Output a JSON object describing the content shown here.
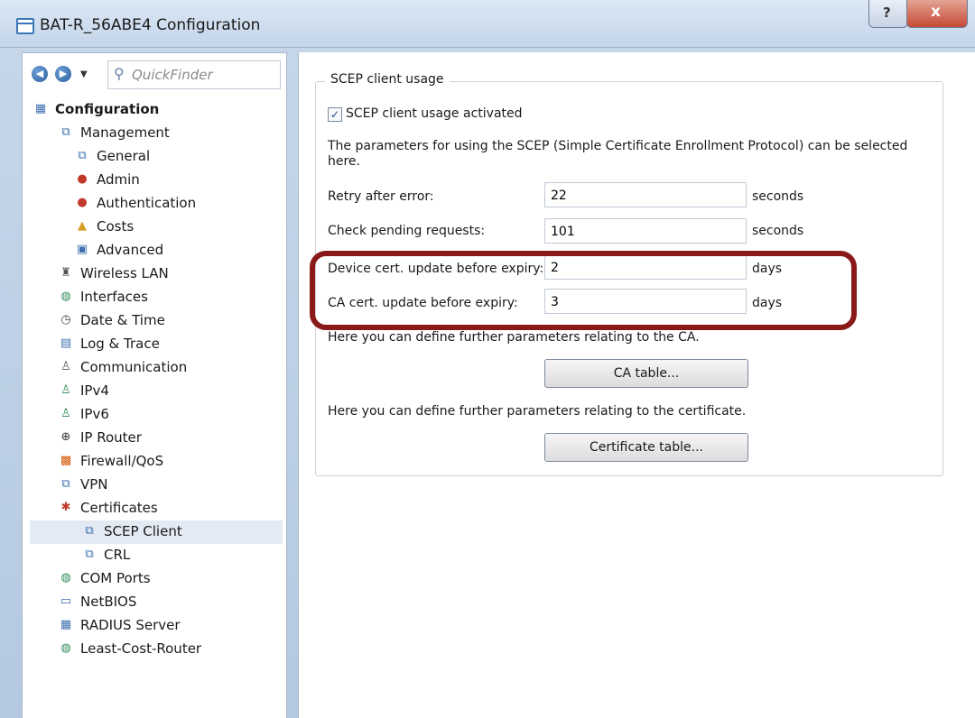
{
  "window": {
    "title": "BAT-R_56ABE4 Configuration",
    "help_label": "?",
    "close_label": "x"
  },
  "nav": {
    "back_icon": "arrow-left-icon",
    "forward_icon": "arrow-right-icon",
    "quickfinder_placeholder": "QuickFinder"
  },
  "tree": {
    "items": [
      {
        "label": "Configuration",
        "icon": "config-icon"
      },
      {
        "label": "Management",
        "icon": "network-icon"
      },
      {
        "label": "General",
        "icon": "network-icon"
      },
      {
        "label": "Admin",
        "icon": "user-icon"
      },
      {
        "label": "Authentication",
        "icon": "user-icon"
      },
      {
        "label": "Costs",
        "icon": "costs-icon"
      },
      {
        "label": "Advanced",
        "icon": "advanced-icon"
      },
      {
        "label": "Wireless LAN",
        "icon": "wireless-icon"
      },
      {
        "label": "Interfaces",
        "icon": "globe-icon"
      },
      {
        "label": "Date & Time",
        "icon": "clock-icon"
      },
      {
        "label": "Log & Trace",
        "icon": "log-icon"
      },
      {
        "label": "Communication",
        "icon": "communication-icon"
      },
      {
        "label": "IPv4",
        "icon": "person-icon"
      },
      {
        "label": "IPv6",
        "icon": "person-icon"
      },
      {
        "label": "IP Router",
        "icon": "router-icon"
      },
      {
        "label": "Firewall/QoS",
        "icon": "firewall-icon"
      },
      {
        "label": "VPN",
        "icon": "network-icon"
      },
      {
        "label": "Certificates",
        "icon": "certificate-icon"
      },
      {
        "label": "SCEP Client",
        "icon": "network-icon"
      },
      {
        "label": "CRL",
        "icon": "network-icon"
      },
      {
        "label": "COM Ports",
        "icon": "globe-icon"
      },
      {
        "label": "NetBIOS",
        "icon": "window-icon"
      },
      {
        "label": "RADIUS Server",
        "icon": "radius-icon"
      },
      {
        "label": "Least-Cost-Router",
        "icon": "globe-icon"
      }
    ]
  },
  "main": {
    "group_title": "SCEP client usage",
    "checkbox": {
      "label": "SCEP client usage activated",
      "checked": true,
      "mark": "✓"
    },
    "description": "The parameters for using the SCEP (Simple Certificate Enrollment Protocol) can be selected here.",
    "fields": [
      {
        "label": "Retry after error:",
        "value": "22",
        "unit": "seconds"
      },
      {
        "label": "Check pending requests:",
        "value": "101",
        "unit": "seconds"
      },
      {
        "label": "Device cert. update before expiry:",
        "value": "2",
        "unit": "days"
      },
      {
        "label": "CA cert. update before expiry:",
        "value": "3",
        "unit": "days"
      }
    ],
    "ca_text": "Here you can define further parameters relating to the CA.",
    "ca_button": "CA table...",
    "cert_text": "Here you can define further parameters relating to the certificate.",
    "cert_button": "Certificate table..."
  },
  "colors": {
    "highlight": "#8a1a1a",
    "selected": "#e3eaf3"
  }
}
